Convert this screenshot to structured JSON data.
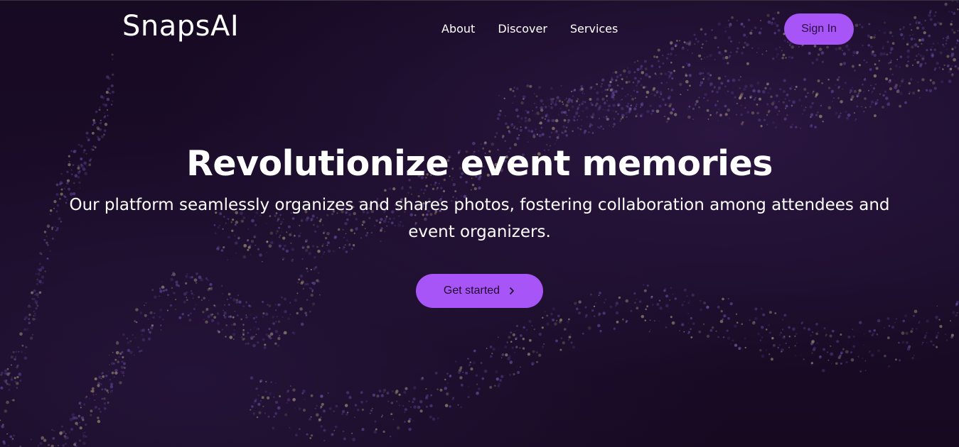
{
  "header": {
    "logo": "SnapsAI",
    "nav": [
      "About",
      "Discover",
      "Services"
    ],
    "sign_in_label": "Sign In"
  },
  "hero": {
    "title": "Revolutionize event memories",
    "subtitle": "Our platform seamlessly organizes and shares photos, fostering collaboration among attendees and event organizers.",
    "cta_label": "Get started",
    "cta_icon": "chevron-right-icon"
  },
  "colors": {
    "background": "#150820",
    "accent": "#a855f7",
    "particle_purple": "#6b4fa8",
    "particle_gold": "#b9a882"
  }
}
